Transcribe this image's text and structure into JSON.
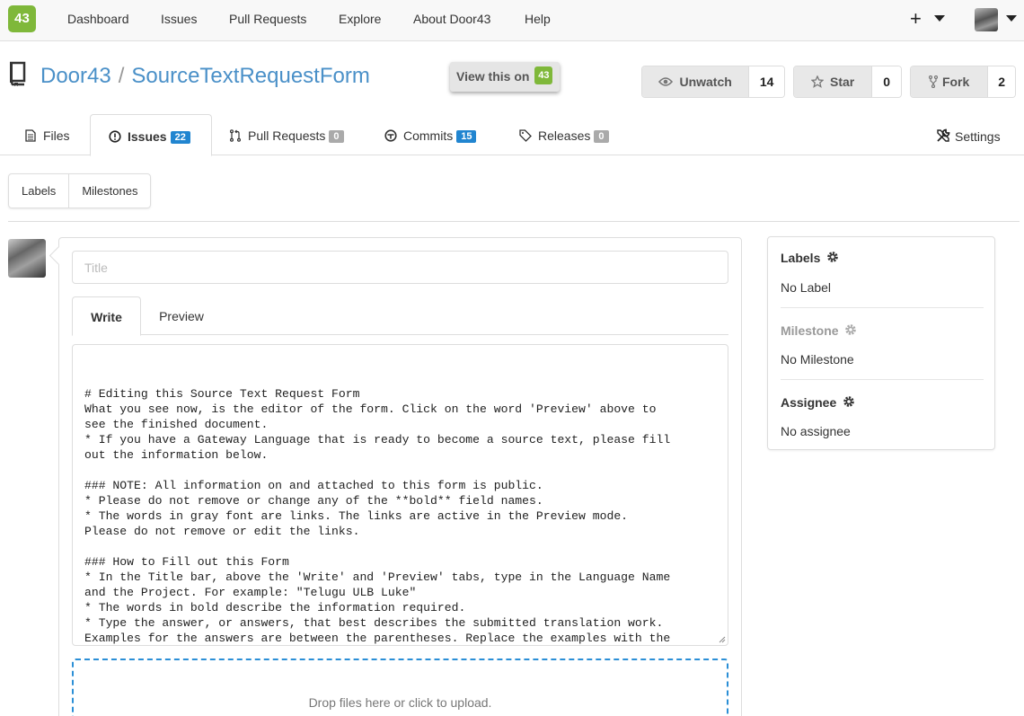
{
  "topnav": {
    "logo_text": "43",
    "links": [
      "Dashboard",
      "Issues",
      "Pull Requests",
      "Explore",
      "About Door43",
      "Help"
    ],
    "plus": "+"
  },
  "repo": {
    "owner": "Door43",
    "separator": "/",
    "name": "SourceTextRequestForm",
    "view_on_label": "View this on",
    "view_on_logo": "43",
    "unwatch_label": "Unwatch",
    "unwatch_count": "14",
    "star_label": "Star",
    "star_count": "0",
    "fork_label": "Fork",
    "fork_count": "2"
  },
  "tabs": {
    "files": "Files",
    "issues": "Issues",
    "issues_count": "22",
    "pulls": "Pull Requests",
    "pulls_count": "0",
    "commits": "Commits",
    "commits_count": "15",
    "releases": "Releases",
    "releases_count": "0",
    "settings": "Settings"
  },
  "subnav": {
    "labels": "Labels",
    "milestones": "Milestones"
  },
  "form": {
    "title_placeholder": "Title",
    "title_value": "",
    "write_tab": "Write",
    "preview_tab": "Preview",
    "body": "# Editing this Source Text Request Form\nWhat you see now, is the editor of the form. Click on the word 'Preview' above to\nsee the finished document.\n* If you have a Gateway Language that is ready to become a source text, please fill\nout the information below.\n\n### NOTE: All information on and attached to this form is public.\n* Please do not remove or change any of the **bold** field names.\n* The words in gray font are links. The links are active in the Preview mode.\nPlease do not remove or edit the links.\n\n### How to Fill out this Form\n* In the Title bar, above the 'Write' and 'Preview' tabs, type in the Language Name\nand the Project. For example: \"Telugu ULB Luke\"\n* The words in bold describe the information required.\n* Type the answer, or answers, that best describes the submitted translation work.\nExamples for the answers are between the parentheses. Replace the examples with the\ninformation.\n    * Here is an example of the **Resource Information** section:",
    "dropzone_text": "Drop files here or click to upload."
  },
  "sidebar": {
    "labels_head": "Labels",
    "labels_value": "No Label",
    "milestone_head": "Milestone",
    "milestone_value": "No Milestone",
    "assignee_head": "Assignee",
    "assignee_value": "No assignee"
  },
  "colors": {
    "logo_green": "#7fb83a",
    "link_blue": "#4a90c8",
    "badge_blue": "#2185d0",
    "dropzone_border": "#2b8fd6"
  },
  "icons": [
    "repo-icon",
    "eye-icon",
    "star-icon",
    "fork-icon",
    "file-text-icon",
    "issue-opened-icon",
    "git-pull-request-icon",
    "git-commit-icon",
    "tag-icon",
    "tools-icon",
    "gear-icon",
    "chevron-down-icon",
    "plus-icon"
  ]
}
